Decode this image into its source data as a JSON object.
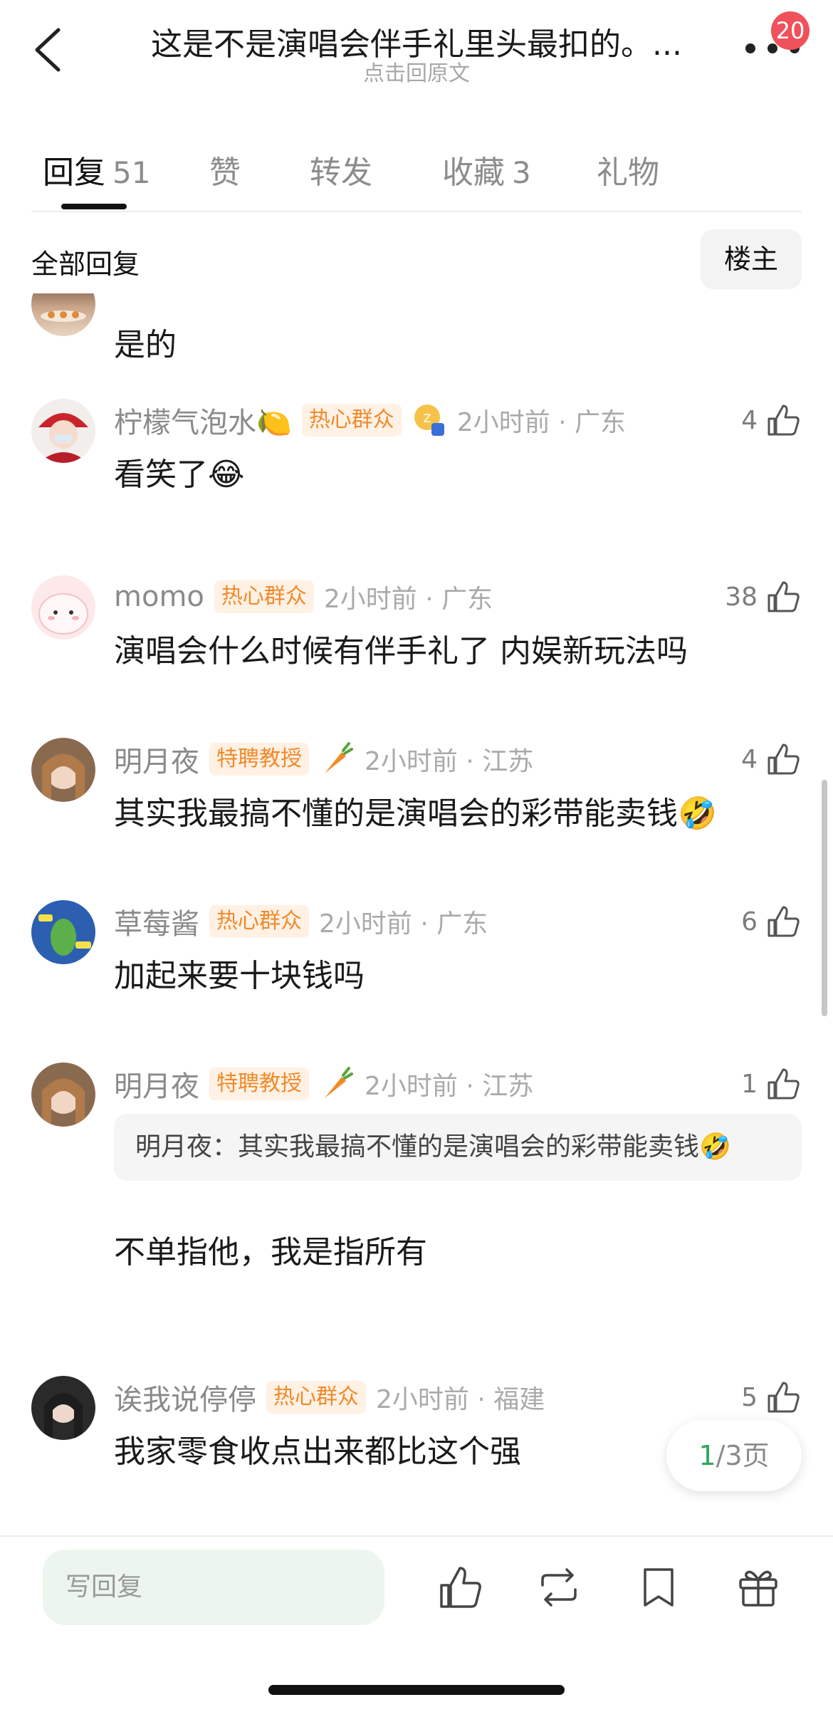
{
  "header": {
    "title": "这是不是演唱会伴手礼里头最扣的。...",
    "subtitle": "点击回原文",
    "notification_count": "20"
  },
  "tabs": [
    {
      "label": "回复",
      "count": "51",
      "active": true
    },
    {
      "label": "赞",
      "count": "",
      "active": false
    },
    {
      "label": "转发",
      "count": "",
      "active": false
    },
    {
      "label": "收藏",
      "count": "3",
      "active": false
    },
    {
      "label": "礼物",
      "count": "",
      "active": false
    }
  ],
  "filter": {
    "label": "全部回复",
    "owner_button": "楼主"
  },
  "comments": [
    {
      "text": "是的"
    },
    {
      "user": "柠檬气泡水🍋",
      "tag": "热心群众",
      "time": "2小时前 · 广东",
      "likes": "4",
      "text": "看笑了😂"
    },
    {
      "user": "momo",
      "tag": "热心群众",
      "time": "2小时前 · 广东",
      "likes": "38",
      "text": "演唱会什么时候有伴手礼了 内娱新玩法吗"
    },
    {
      "user": "明月夜",
      "tag": "特聘教授",
      "time": "2小时前 · 江苏",
      "likes": "4",
      "text": "其实我最搞不懂的是演唱会的彩带能卖钱🤣"
    },
    {
      "user": "草莓酱",
      "tag": "热心群众",
      "time": "2小时前 · 广东",
      "likes": "6",
      "text": "加起来要十块钱吗"
    },
    {
      "user": "明月夜",
      "tag": "特聘教授",
      "time": "2小时前 · 江苏",
      "likes": "1",
      "quote": "明月夜：其实我最搞不懂的是演唱会的彩带能卖钱🤣",
      "text": "不单指他，我是指所有"
    },
    {
      "user": "诶我说停停",
      "tag": "热心群众",
      "time": "2小时前 · 福建",
      "likes": "5",
      "text": "我家零食收点出来都比这个强"
    }
  ],
  "pagination": {
    "current": "1",
    "total_text": "/3页"
  },
  "bottom_bar": {
    "reply_placeholder": "写回复",
    "icons": [
      "like-icon",
      "repost-icon",
      "bookmark-icon",
      "gift-icon"
    ]
  },
  "colors": {
    "tag_text": "#f08a2c",
    "tag_bg": "#fff1e4",
    "badge": "#f0515a",
    "page_current": "#2fa65a",
    "reply_bg": "#edf6ee"
  }
}
